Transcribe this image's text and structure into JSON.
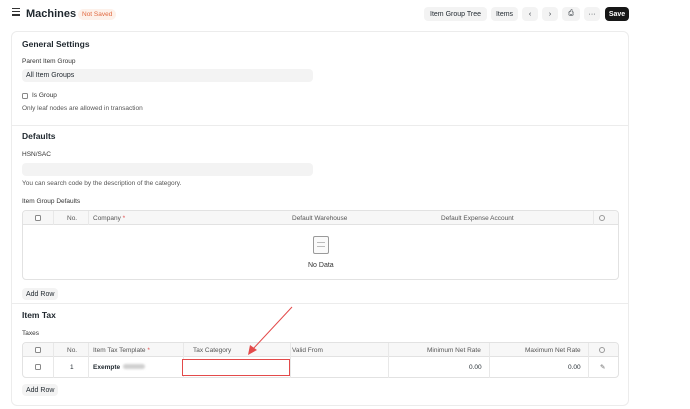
{
  "header": {
    "title": "Machines",
    "status": "Not Saved",
    "buttons": {
      "item_group_tree": "Item Group Tree",
      "items": "Items",
      "prev": "‹",
      "next": "›",
      "print": "⎙",
      "more": "···",
      "save": "Save"
    }
  },
  "general": {
    "title": "General Settings",
    "parent_label": "Parent Item Group",
    "parent_value": "All Item Groups",
    "is_group_label": "Is Group",
    "is_group_help": "Only leaf nodes are allowed in transaction"
  },
  "defaults": {
    "title": "Defaults",
    "hsn_label": "HSN/SAC",
    "hsn_value": "",
    "hsn_help": "You can search code by the description of the category.",
    "table_label": "Item Group Defaults",
    "columns": {
      "no": "No.",
      "company": "Company",
      "required": "*",
      "warehouse": "Default Warehouse",
      "expense": "Default Expense Account"
    },
    "no_data": "No Data",
    "add_row": "Add Row"
  },
  "item_tax": {
    "title": "Item Tax",
    "table_label": "Taxes",
    "columns": {
      "no": "No.",
      "template": "Item Tax Template",
      "required": "*",
      "tax_category": "Tax Category",
      "valid_from": "Valid From",
      "min_rate": "Minimum Net Rate",
      "max_rate": "Maximum Net Rate"
    },
    "rows": [
      {
        "no": "1",
        "template": "Exempte",
        "tax_category": "",
        "valid_from": "",
        "min": "0.00",
        "max": "0.00"
      }
    ],
    "add_row": "Add Row"
  },
  "colors": {
    "accent_badge": "#e0683f",
    "highlight_red": "#e34a4a",
    "save_bg": "#171717"
  }
}
